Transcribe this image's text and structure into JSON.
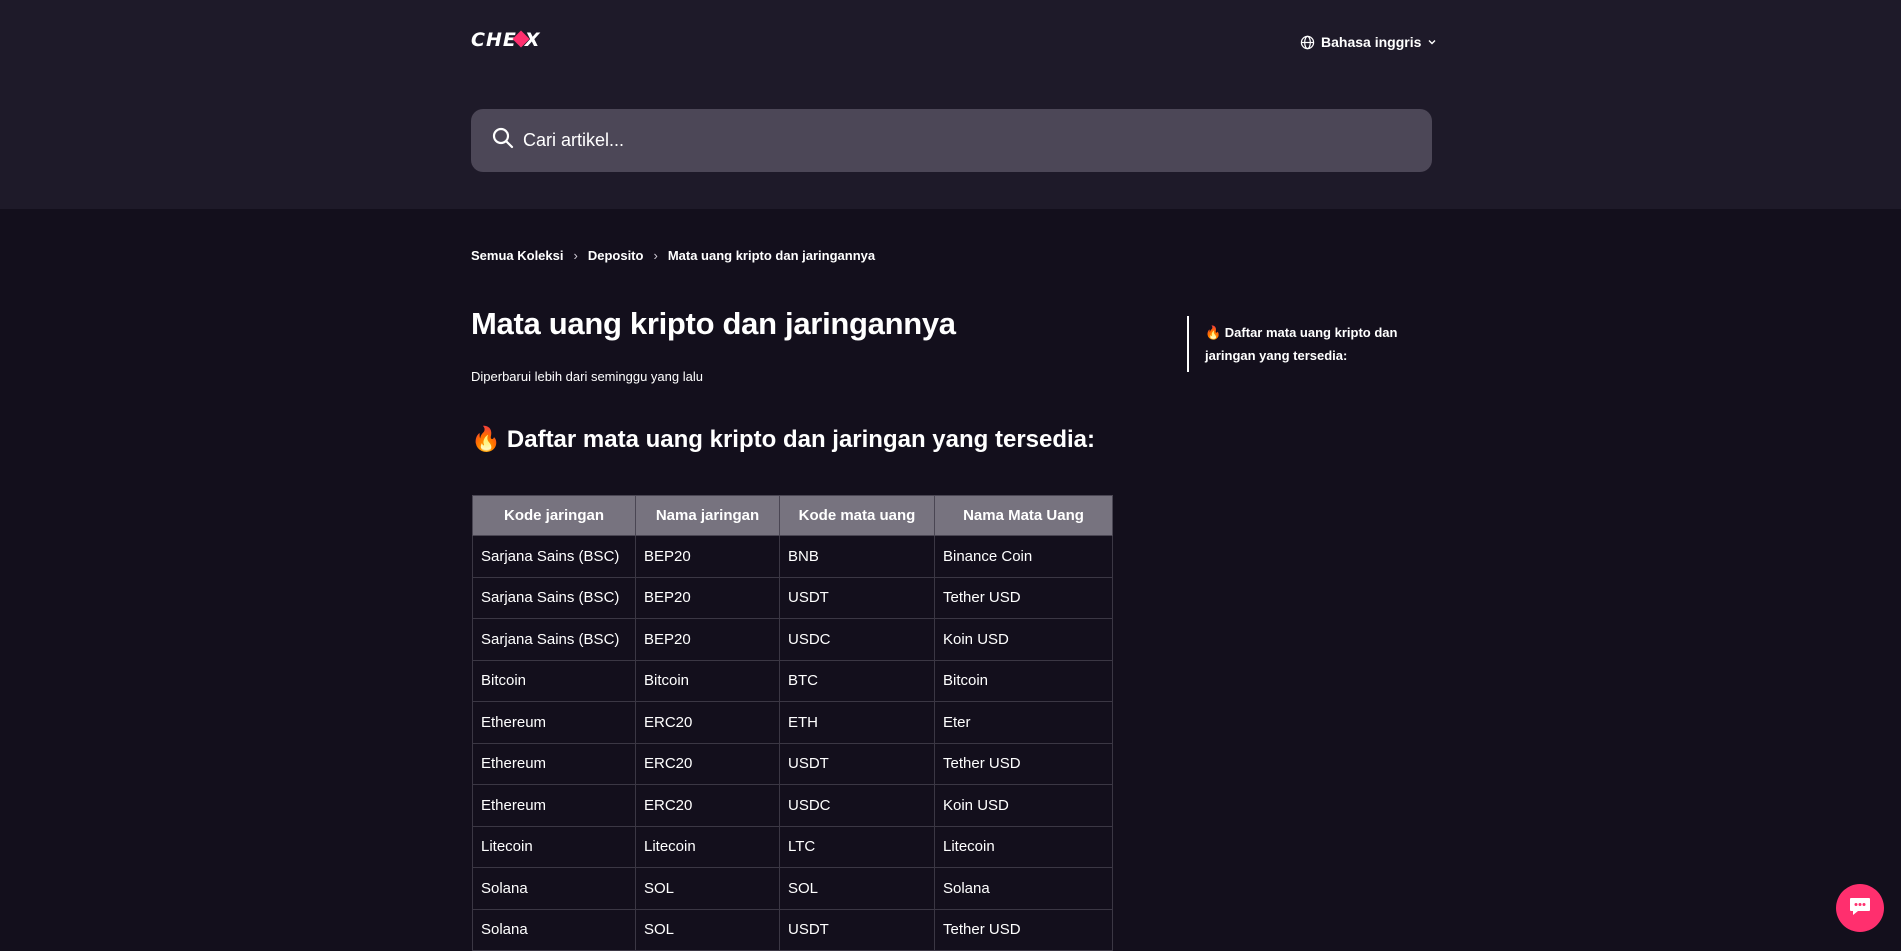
{
  "header": {
    "logo_text": "CHEXX",
    "language_label": "Bahasa inggris"
  },
  "search": {
    "placeholder": "Cari artikel..."
  },
  "breadcrumb": {
    "items": [
      "Semua Koleksi",
      "Deposito",
      "Mata uang kripto dan jaringannya"
    ]
  },
  "article": {
    "title": "Mata uang kripto dan jaringannya",
    "updated": "Diperbarui lebih dari seminggu yang lalu",
    "section_heading": "Daftar mata uang kripto dan jaringan yang tersedia:",
    "section_emoji": "🔥"
  },
  "toc": {
    "items": [
      "🔥 Daftar mata uang kripto dan jaringan yang tersedia:"
    ]
  },
  "table": {
    "headers": [
      "Kode jaringan",
      "Nama jaringan",
      "Kode mata uang",
      "Nama Mata Uang"
    ],
    "rows": [
      [
        "Sarjana Sains (BSC)",
        "BEP20",
        "BNB",
        "Binance Coin"
      ],
      [
        "Sarjana Sains (BSC)",
        "BEP20",
        "USDT",
        "Tether USD"
      ],
      [
        "Sarjana Sains (BSC)",
        "BEP20",
        "USDC",
        "Koin USD"
      ],
      [
        "Bitcoin",
        "Bitcoin",
        "BTC",
        "Bitcoin"
      ],
      [
        "Ethereum",
        "ERC20",
        "ETH",
        "Eter"
      ],
      [
        "Ethereum",
        "ERC20",
        "USDT",
        "Tether USD"
      ],
      [
        "Ethereum",
        "ERC20",
        "USDC",
        "Koin USD"
      ],
      [
        "Litecoin",
        "Litecoin",
        "LTC",
        "Litecoin"
      ],
      [
        "Solana",
        "SOL",
        "SOL",
        "Solana"
      ],
      [
        "Solana",
        "SOL",
        "USDT",
        "Tether USD"
      ]
    ]
  },
  "icons": {
    "search": "search-icon",
    "globe": "globe-icon",
    "chevron": "chevron-down-icon",
    "chat": "chat-icon"
  },
  "colors": {
    "background": "#130f1c",
    "header_background": "#1e1a29",
    "search_background": "#4c4757",
    "accent": "#ff2f6e",
    "table_header": "#77737f"
  }
}
